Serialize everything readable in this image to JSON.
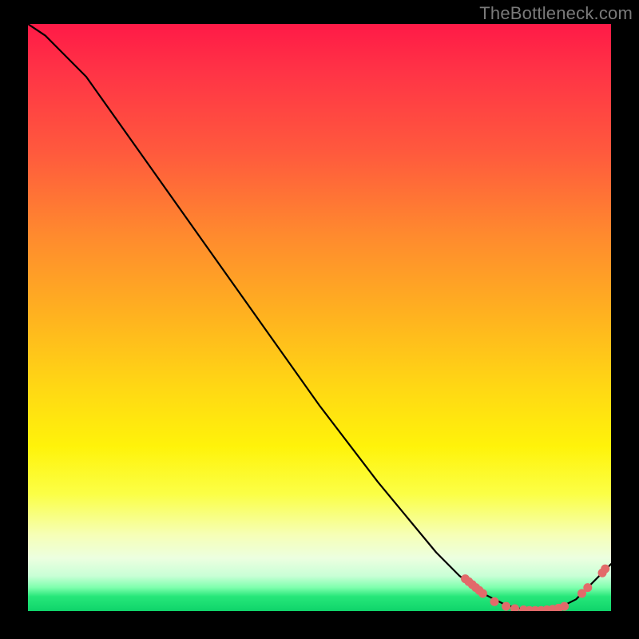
{
  "watermark": "TheBottleneck.com",
  "chart_data": {
    "type": "line",
    "title": "",
    "xlabel": "",
    "ylabel": "",
    "xlim": [
      0,
      100
    ],
    "ylim": [
      0,
      100
    ],
    "series": [
      {
        "name": "curve",
        "x": [
          0,
          3,
          6,
          10,
          20,
          30,
          40,
          50,
          60,
          70,
          74,
          78,
          82,
          86,
          90,
          94,
          98,
          100
        ],
        "y": [
          100,
          98,
          95,
          91,
          77,
          63,
          49,
          35,
          22,
          10,
          6,
          3,
          1,
          0,
          0,
          2,
          6,
          8
        ]
      }
    ],
    "markers": [
      {
        "x": 75.0,
        "y": 5.5
      },
      {
        "x": 75.6,
        "y": 5.0
      },
      {
        "x": 76.2,
        "y": 4.5
      },
      {
        "x": 76.8,
        "y": 4.0
      },
      {
        "x": 77.4,
        "y": 3.5
      },
      {
        "x": 78.0,
        "y": 3.0
      },
      {
        "x": 80.0,
        "y": 1.6
      },
      {
        "x": 82.0,
        "y": 0.8
      },
      {
        "x": 83.5,
        "y": 0.4
      },
      {
        "x": 85.0,
        "y": 0.2
      },
      {
        "x": 86.0,
        "y": 0.1
      },
      {
        "x": 87.0,
        "y": 0.1
      },
      {
        "x": 88.0,
        "y": 0.1
      },
      {
        "x": 89.0,
        "y": 0.2
      },
      {
        "x": 90.0,
        "y": 0.3
      },
      {
        "x": 91.0,
        "y": 0.5
      },
      {
        "x": 92.0,
        "y": 0.8
      },
      {
        "x": 95.0,
        "y": 3.0
      },
      {
        "x": 96.0,
        "y": 4.0
      },
      {
        "x": 98.5,
        "y": 6.5
      },
      {
        "x": 99.0,
        "y": 7.2
      }
    ],
    "colors": {
      "curve_stroke": "#000000",
      "marker_fill": "#e26a6a",
      "gradient_top": "#ff1a47",
      "gradient_bottom": "#0fd46a"
    }
  }
}
